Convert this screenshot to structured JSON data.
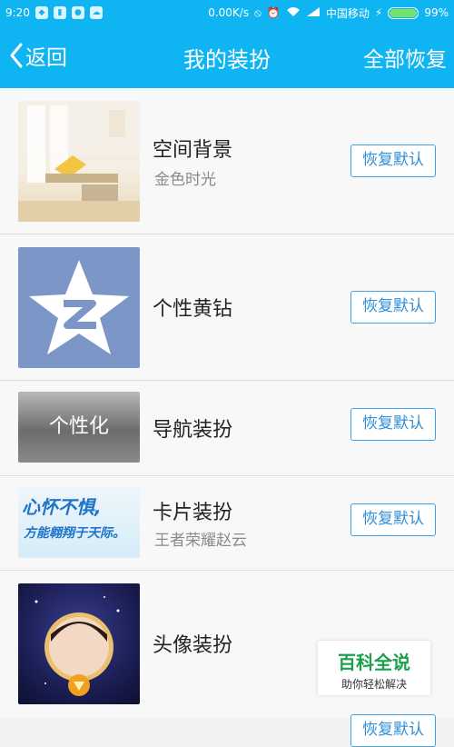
{
  "status_bar": {
    "time": "9:20",
    "speed": "0.00K/s",
    "carrier": "中国移动",
    "battery": "99%"
  },
  "nav": {
    "back_label": "返回",
    "title": "我的装扮",
    "restore_all_label": "全部恢复"
  },
  "items": [
    {
      "name": "空间背景",
      "subtitle": "金色时光",
      "button": "恢复默认"
    },
    {
      "name": "个性黄钻",
      "subtitle": "",
      "button": "恢复默认"
    },
    {
      "name": "导航装扮",
      "subtitle": "",
      "button": "恢复默认",
      "thumb_text": "个性化"
    },
    {
      "name": "卡片装扮",
      "subtitle": "王者荣耀赵云",
      "button": "恢复默认",
      "thumb_text_1": "心怀不惧,",
      "thumb_text_2": "方能翱翔于天际。"
    },
    {
      "name": "头像装扮",
      "subtitle": "",
      "button": "恢复默认"
    }
  ],
  "watermark": {
    "title": "百科全说",
    "subtitle": "助你轻松解决"
  },
  "colors": {
    "header": "#0fb5f2",
    "button_border": "#3fa0e6",
    "watermark_green": "#1aa04a"
  }
}
